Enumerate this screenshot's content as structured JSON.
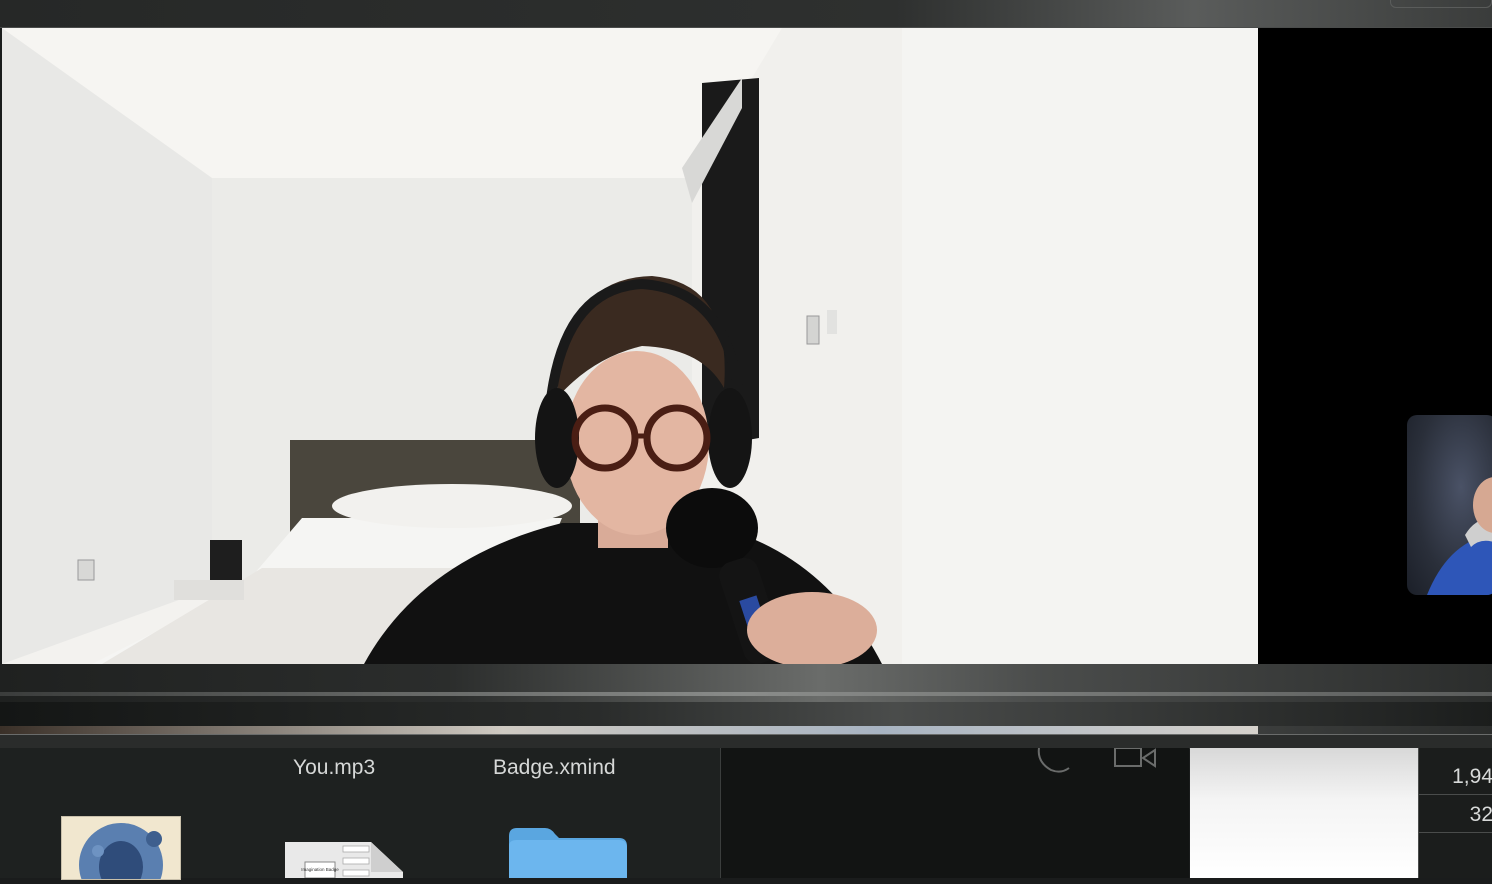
{
  "finder": {
    "files": [
      {
        "label": "You.mp3",
        "icon": "audio-file-icon"
      },
      {
        "label": "Badge.xmind",
        "icon": "xmind-file-icon"
      }
    ],
    "thumbnail_texts": [
      "Imagination Badge"
    ]
  },
  "table": {
    "cells": [
      "1,94",
      "32"
    ]
  },
  "colors": {
    "wall": "#f3f2ef",
    "folder_blue": "#6cb6ee",
    "shirt": "#111111"
  }
}
